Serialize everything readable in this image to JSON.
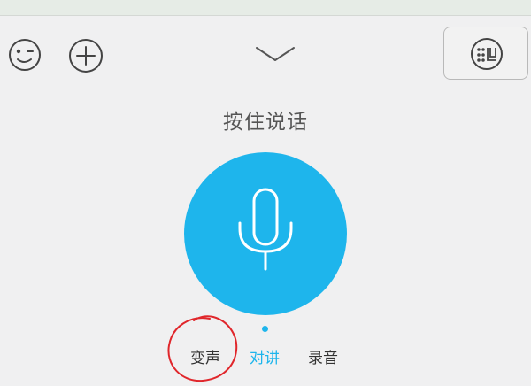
{
  "colors": {
    "accent": "#1eb5ec",
    "background": "#f0f0f1",
    "annotation": "#e0262b"
  },
  "toolbar": {
    "emoji_icon": "emoji-icon",
    "plus_icon": "plus-icon",
    "collapse_icon": "chevron-down-icon",
    "keyboard_icon": "keyboard-icon"
  },
  "voice": {
    "hint": "按住说话",
    "mic_icon": "microphone-icon"
  },
  "modes": {
    "items": [
      "变声",
      "对讲",
      "录音"
    ],
    "selected": "对讲"
  }
}
